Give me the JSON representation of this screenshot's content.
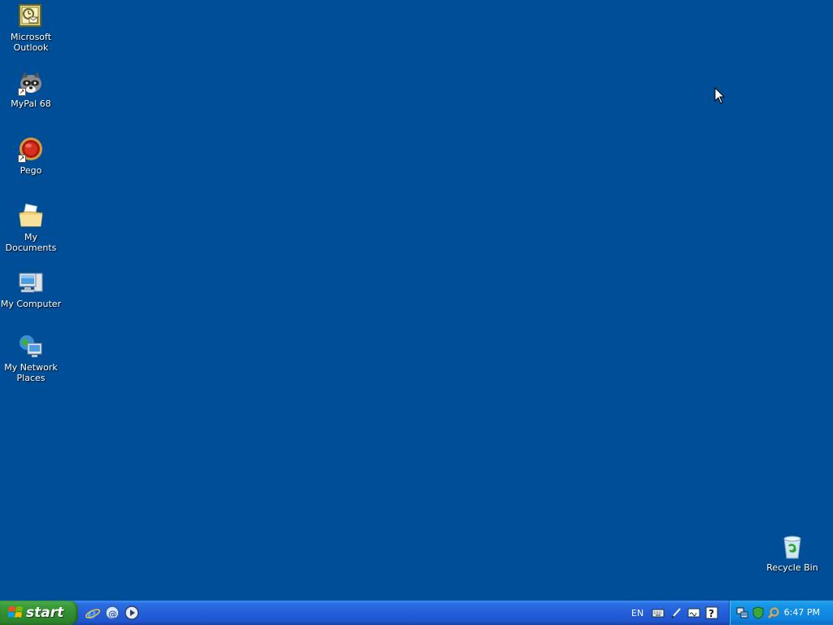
{
  "desktop": {
    "background_color": "#004e98",
    "icons": [
      {
        "label": "Microsoft Outlook",
        "icon": "outlook-icon",
        "shortcut": false
      },
      {
        "label": "MyPal 68",
        "icon": "mypal-raccoon-icon",
        "shortcut": true
      },
      {
        "label": "Pego",
        "icon": "pego-red-orb-icon",
        "shortcut": true
      },
      {
        "label": "My Documents",
        "icon": "folder-documents-icon",
        "shortcut": false
      },
      {
        "label": "My Computer",
        "icon": "computer-icon",
        "shortcut": false
      },
      {
        "label": "My Network Places",
        "icon": "network-places-icon",
        "shortcut": false
      },
      {
        "label": "Recycle Bin",
        "icon": "recycle-bin-icon",
        "shortcut": false
      }
    ]
  },
  "taskbar": {
    "start_label": "start",
    "quick_launch": [
      {
        "icon": "internet-explorer-icon"
      },
      {
        "icon": "outlook-express-icon"
      },
      {
        "icon": "media-player-icon"
      }
    ],
    "language": "EN",
    "language_bar_tools": [
      {
        "icon": "keyboard-icon"
      },
      {
        "icon": "pen-icon"
      },
      {
        "icon": "handwriting-pad-icon"
      },
      {
        "icon": "help-icon"
      }
    ],
    "tray_icons": [
      {
        "icon": "network-connection-icon"
      },
      {
        "icon": "security-shield-icon"
      },
      {
        "icon": "search-magnifier-icon"
      }
    ],
    "clock": "6:47 PM"
  }
}
